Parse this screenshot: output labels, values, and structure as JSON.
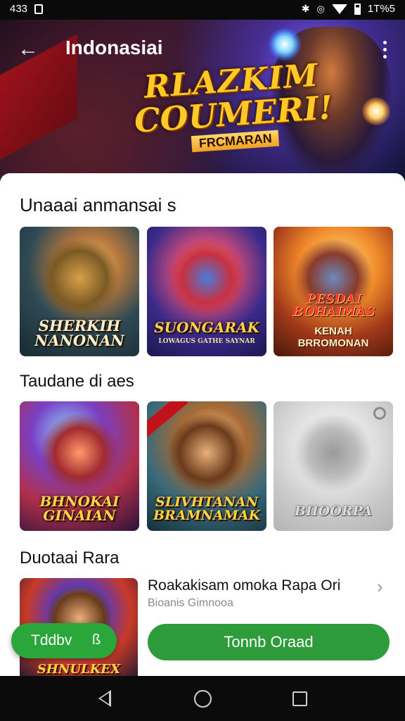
{
  "status_bar": {
    "time": "433",
    "battery": "1T%5"
  },
  "header": {
    "title": "Indonasiai"
  },
  "hero_banner": {
    "logo_line1": "RLAZKIM",
    "logo_line2": "COUMERI!",
    "logo_sub": "FRCMARAN"
  },
  "sections": [
    {
      "title": "Unaaai anmansai s",
      "cards": [
        {
          "caption_lines": [
            "SHERKIH",
            "NANONAN"
          ]
        },
        {
          "caption_lines": [
            "SUONGARAK"
          ],
          "small": "LOWAGUS GATHE SAYNAR"
        },
        {
          "caption_lines": [
            "PESDAI",
            "BOHAIMAS"
          ],
          "caption2_lines": [
            "KENAH",
            "BRROMONAN"
          ]
        }
      ]
    },
    {
      "title": "Taudane di aes",
      "cards": [
        {
          "caption_lines": [
            "BHNOKAI",
            "GINAIAN"
          ]
        },
        {
          "caption_lines": [
            "SLIVHTANAN",
            "BRAMNAMAK"
          ]
        },
        {
          "caption_lines": [
            "BIIOORPA"
          ]
        }
      ]
    },
    {
      "title": "Duotaai Rara",
      "item": {
        "thumb_caption": "SHNULKEX",
        "title": "Roakakisam omoka Rapa Ori",
        "subtitle": "Bioanis Gimnooa"
      }
    }
  ],
  "floating_pill": {
    "label": "Tddbv",
    "icon_glyph": "ß"
  },
  "primary_button": {
    "label": "Tonnb Oraad"
  },
  "colors": {
    "green": "#2e9c3a",
    "sheet": "#ffffff",
    "status_bar": "#0a0a0a"
  },
  "icons": [
    "back-arrow-icon",
    "more-vert-icon",
    "chevron-right-icon",
    "nav-back-icon",
    "nav-home-icon",
    "nav-recents-icon"
  ]
}
